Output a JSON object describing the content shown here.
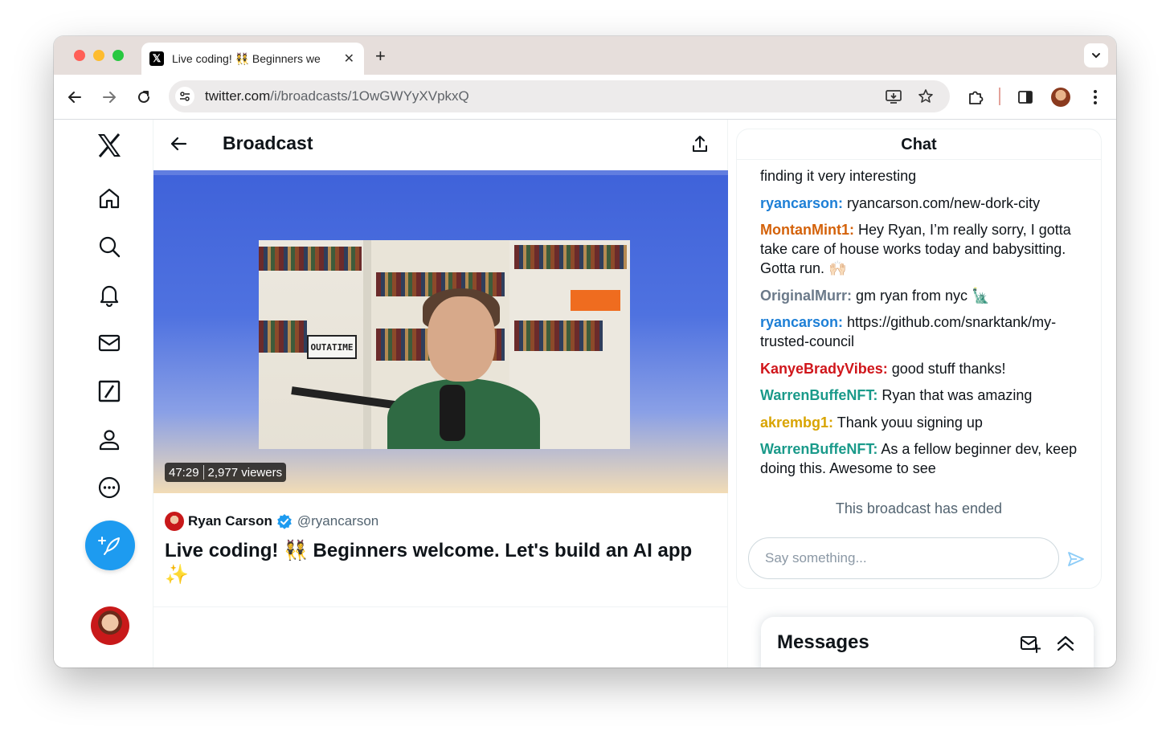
{
  "browser": {
    "tab_title": "Live coding! 👯 Beginners we",
    "tab_favicon": "𝕏",
    "tab_close": "✕",
    "new_tab": "+",
    "url_host": "twitter.com",
    "url_path": "/i/broadcasts/1OwGWYyXVpkxQ"
  },
  "nav": {
    "items": [
      "x-logo",
      "home-icon",
      "explore-icon",
      "notifications-icon",
      "messages-icon",
      "grok-icon",
      "profile-icon",
      "more-icon"
    ]
  },
  "header": {
    "title": "Broadcast"
  },
  "video": {
    "duration": "47:29",
    "viewers": "2,977 viewers",
    "plate_text": "OUTATIME"
  },
  "post": {
    "author_name": "Ryan Carson",
    "author_handle": "@ryancarson",
    "title": "Live coding! 👯 Beginners welcome. Let's build an AI app ✨"
  },
  "chat": {
    "title": "Chat",
    "messages": [
      {
        "user": "",
        "text": "finding it very interesting",
        "color": "#0f1419"
      },
      {
        "user": "ryancarson:",
        "text": " ryancarson.com/new-dork-city",
        "color": "#1d7fd6"
      },
      {
        "user": "MontanMint1:",
        "text": " Hey Ryan, I’m really sorry, I gotta take care of house works today and babysitting. Gotta run. 🙌🏻",
        "color": "#d4620a"
      },
      {
        "user": "OriginalMurr:",
        "text": " gm ryan from nyc 🗽",
        "color": "#6b7a8a"
      },
      {
        "user": "ryancarson:",
        "text": " https://github.com/snarktank/my-trusted-council",
        "color": "#1d7fd6"
      },
      {
        "user": "KanyeBradyVibes:",
        "text": " good stuff thanks!",
        "color": "#d0161b"
      },
      {
        "user": "WarrenBuffeNFT:",
        "text": " Ryan that was amazing",
        "color": "#1a9a8a"
      },
      {
        "user": "akrembg1:",
        "text": " Thank youu signing up",
        "color": "#d9a400"
      },
      {
        "user": "WarrenBuffeNFT:",
        "text": " As a fellow beginner dev, keep doing this. Awesome to see",
        "color": "#1a9a8a"
      }
    ],
    "ended": "This broadcast has ended",
    "input_placeholder": "Say something..."
  },
  "messages_dock": {
    "title": "Messages"
  },
  "colors": {
    "accent": "#1d9bf0",
    "tab_strip": "#e6dedb"
  }
}
